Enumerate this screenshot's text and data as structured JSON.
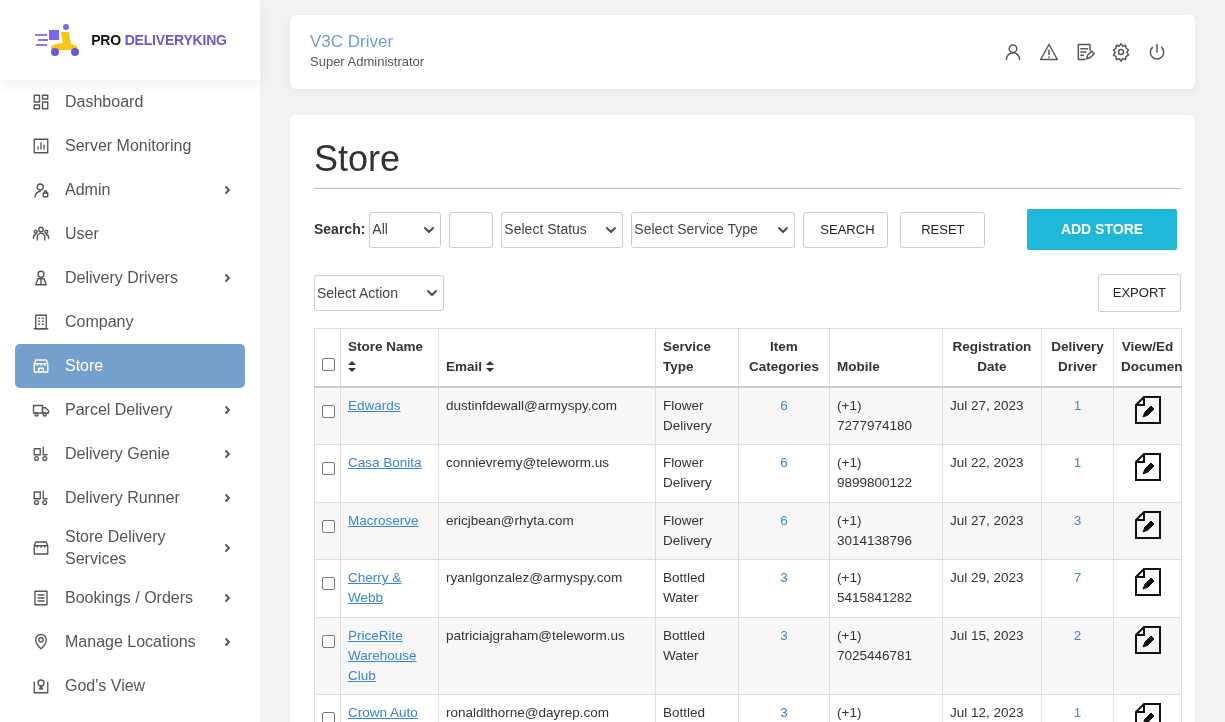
{
  "sidebar": {
    "logo": {
      "prefix": "PRO",
      "name": "DELIVERYKING"
    },
    "items": [
      {
        "label": "Dashboard",
        "selected": false,
        "has_submenu": false
      },
      {
        "label": "Server Monitoring",
        "selected": false,
        "has_submenu": false
      },
      {
        "label": "Admin",
        "selected": false,
        "has_submenu": true
      },
      {
        "label": "User",
        "selected": false,
        "has_submenu": false
      },
      {
        "label": "Delivery Drivers",
        "selected": false,
        "has_submenu": true
      },
      {
        "label": "Company",
        "selected": false,
        "has_submenu": false
      },
      {
        "label": "Store",
        "selected": true,
        "has_submenu": false
      },
      {
        "label": "Parcel Delivery",
        "selected": false,
        "has_submenu": true
      },
      {
        "label": "Delivery Genie",
        "selected": false,
        "has_submenu": true
      },
      {
        "label": "Delivery Runner",
        "selected": false,
        "has_submenu": true
      },
      {
        "label": "Store Delivery Services",
        "selected": false,
        "has_submenu": true
      },
      {
        "label": "Bookings / Orders",
        "selected": false,
        "has_submenu": true
      },
      {
        "label": "Manage Locations",
        "selected": false,
        "has_submenu": true
      },
      {
        "label": "God's View",
        "selected": false,
        "has_submenu": false
      }
    ]
  },
  "header": {
    "user_name": "V3C Driver",
    "role": "Super Administrator"
  },
  "page_title": "Store",
  "filters": {
    "label": "Search:",
    "field_select": "All",
    "status_select": "Select Status",
    "service_type_select": "Select Service Type",
    "search_button": "SEARCH",
    "reset_button": "RESET",
    "add_button": "ADD STORE"
  },
  "actions": {
    "action_select": "Select Action",
    "export_button": "EXPORT"
  },
  "table": {
    "select_all_checked": false,
    "columns": [
      {
        "label": "Store Name",
        "sortable": true
      },
      {
        "label": "Email",
        "sortable": true
      },
      {
        "label": "Service Type",
        "sortable": false
      },
      {
        "label": "Item Categories",
        "sortable": false
      },
      {
        "label": "Mobile",
        "sortable": false
      },
      {
        "label": "Registration Date",
        "sortable": false
      },
      {
        "label": "Delivery Driver",
        "sortable": false
      },
      {
        "label": "View/Ed Documen",
        "sortable": false
      }
    ],
    "rows": [
      {
        "checked": false,
        "store_name": "Edwards",
        "email": "dustinfdewall@armyspy.com",
        "service_type": "Flower Delivery",
        "item_categories": "6",
        "mobile_code": "(+1)",
        "mobile_number": "7277974180",
        "registration_date": "Jul 27, 2023",
        "delivery_driver": "1"
      },
      {
        "checked": false,
        "store_name": "Casa Bonita",
        "email": "connievremy@teleworm.us",
        "service_type": "Flower Delivery",
        "item_categories": "6",
        "mobile_code": "(+1)",
        "mobile_number": "9899800122",
        "registration_date": "Jul 22, 2023",
        "delivery_driver": "1"
      },
      {
        "checked": false,
        "store_name": "Macroserve",
        "email": "ericjbean@rhyta.com",
        "service_type": "Flower Delivery",
        "item_categories": "6",
        "mobile_code": "(+1)",
        "mobile_number": "3014138796",
        "registration_date": "Jul 27, 2023",
        "delivery_driver": "3"
      },
      {
        "checked": false,
        "store_name": "Cherry & Webb",
        "email": "ryanlgonzalez@armyspy.com",
        "service_type": "Bottled Water",
        "item_categories": "3",
        "mobile_code": "(+1)",
        "mobile_number": "5415841282",
        "registration_date": "Jul 29, 2023",
        "delivery_driver": "7"
      },
      {
        "checked": false,
        "store_name": "PriceRite Warehouse Club",
        "email": "patriciajgraham@teleworm.us",
        "service_type": "Bottled Water",
        "item_categories": "3",
        "mobile_code": "(+1)",
        "mobile_number": "7025446781",
        "registration_date": "Jul 15, 2023",
        "delivery_driver": "2"
      },
      {
        "checked": false,
        "store_name": "Crown Auto",
        "email": "ronaldlthorne@dayrep.com",
        "service_type": "Bottled",
        "item_categories": "3",
        "mobile_code": "(+1)",
        "registration_date": "Jul 12, 2023",
        "delivery_driver": "1"
      }
    ]
  }
}
